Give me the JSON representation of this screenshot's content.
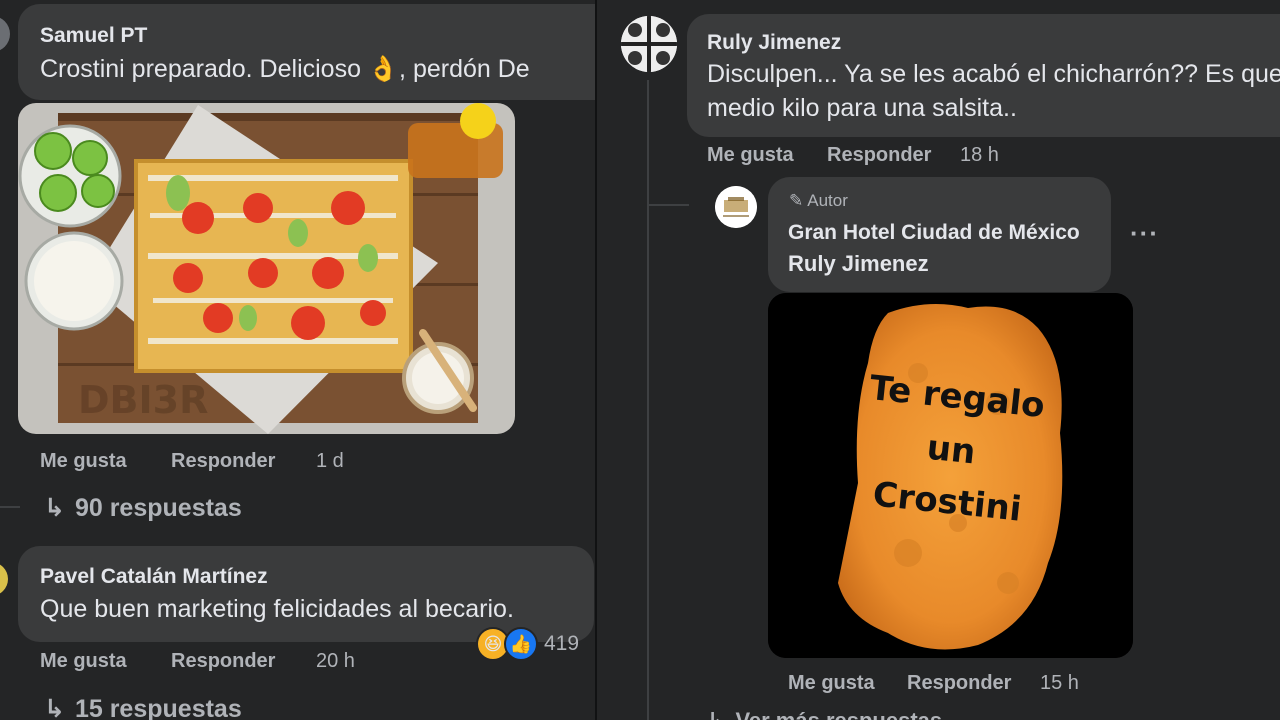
{
  "left": {
    "comments": [
      {
        "author": "Samuel PT",
        "text": "Crostini preparado. Delicioso 👌, perdón De",
        "like": "Me gusta",
        "reply": "Responder",
        "time": "1 d",
        "replies": "90 respuestas"
      },
      {
        "author": "Pavel Catalán Martínez",
        "text": "Que buen marketing felicidades al becario.",
        "like": "Me gusta",
        "reply": "Responder",
        "time": "20 h",
        "reaction_count": "419",
        "replies": "15 respuestas"
      }
    ]
  },
  "right": {
    "comment": {
      "author": "Ruly Jimenez",
      "text_line1": "Disculpen... Ya se les acabó el chicharrón?? Es que",
      "text_line2": "medio kilo para una salsita..",
      "like": "Me gusta",
      "reply": "Responder",
      "time": "18 h"
    },
    "reply": {
      "badge": "Autor",
      "author": "Gran Hotel Ciudad de México",
      "mention": "Ruly Jimenez",
      "image_text": [
        "Te regalo",
        "un",
        "Crostini"
      ],
      "like": "Me gusta",
      "reply": "Responder",
      "time": "15 h",
      "more": "Ver más respuestas"
    }
  },
  "colors": {
    "background": "#242526",
    "bubble": "#3a3b3c",
    "secondary_text": "#b0b3b8",
    "like_blue": "#1877f2"
  },
  "icons": [
    "reply-arrow-icon",
    "pencil-icon",
    "haha-reaction-icon",
    "like-reaction-icon",
    "more-options-icon"
  ]
}
